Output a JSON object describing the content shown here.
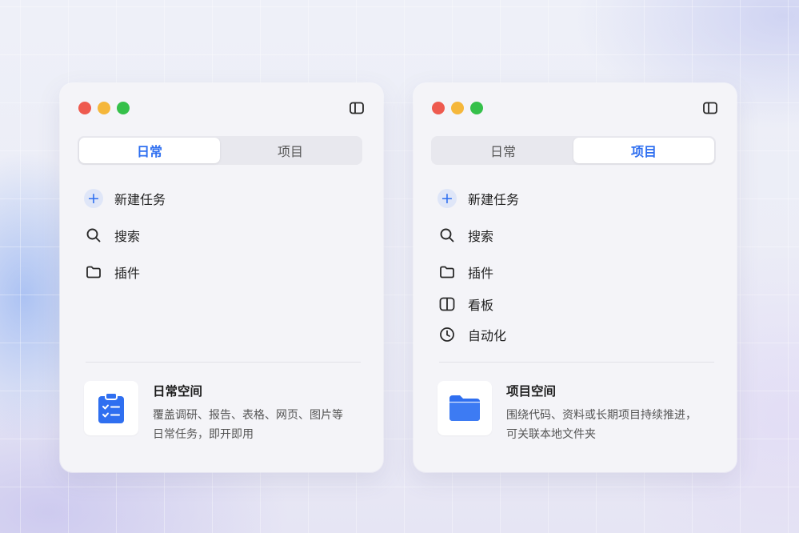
{
  "colors": {
    "accent": "#2f6ff0",
    "traffic_red": "#ee5a4f",
    "traffic_yellow": "#f5b73b",
    "traffic_green": "#35c04a"
  },
  "left_window": {
    "tabs": [
      {
        "label": "日常",
        "active": true
      },
      {
        "label": "项目",
        "active": false
      }
    ],
    "menu": [
      {
        "icon": "plus-circle-icon",
        "label": "新建任务"
      },
      {
        "icon": "search-icon",
        "label": "搜索"
      },
      {
        "icon": "folder-icon",
        "label": "插件"
      }
    ],
    "space": {
      "icon": "clipboard-checklist-icon",
      "title": "日常空间",
      "desc_line1": "覆盖调研、报告、表格、网页、图片等",
      "desc_line2": "日常任务，即开即用"
    }
  },
  "right_window": {
    "tabs": [
      {
        "label": "日常",
        "active": false
      },
      {
        "label": "项目",
        "active": true
      }
    ],
    "menu": [
      {
        "icon": "plus-circle-icon",
        "label": "新建任务"
      },
      {
        "icon": "search-icon",
        "label": "搜索"
      },
      {
        "icon": "folder-icon",
        "label": "插件"
      },
      {
        "icon": "board-icon",
        "label": "看板"
      },
      {
        "icon": "clock-icon",
        "label": "自动化"
      }
    ],
    "space": {
      "icon": "folder-filled-icon",
      "title": "项目空间",
      "desc_line1": "围绕代码、资料或长期项目持续推进，",
      "desc_line2": "可关联本地文件夹"
    }
  }
}
